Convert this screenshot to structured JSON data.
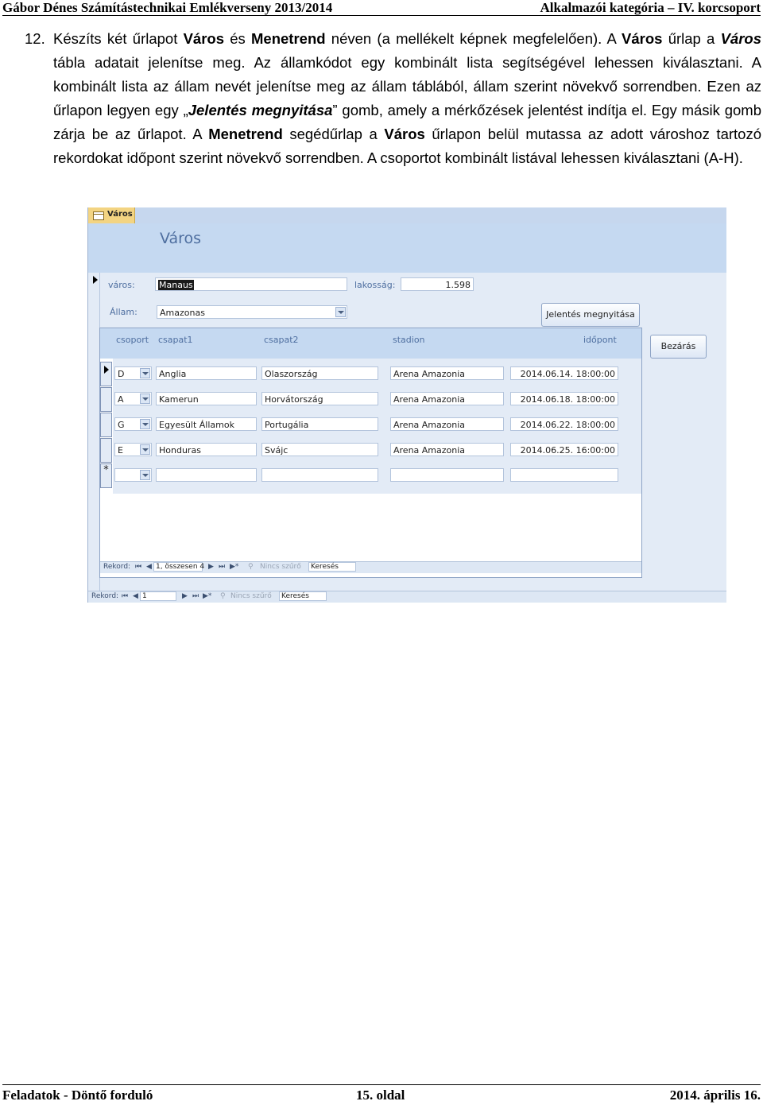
{
  "header": {
    "left": "Gábor Dénes Számítástechnikai Emlékverseny 2013/2014",
    "right": "Alkalmazói kategória – IV. korcsoport"
  },
  "task": {
    "number": "12.",
    "text_parts": [
      "Készíts két űrlapot ",
      "Város",
      " és ",
      "Menetrend",
      " néven (a mellékelt képnek megfelelően). A ",
      "Város",
      " űrlap a ",
      "Város",
      " tábla adatait jelenítse meg. Az államkódot egy kombinált lista segítségével lehessen kiválasztani. A kombinált lista az állam nevét jelenítse meg az állam táblából, állam szerint növekvő sorrendben. Ezen az űrlapon legyen egy „",
      "Jelentés megnyitása",
      "” gomb, amely a mérkőzések jelentést indítja el. Egy másik gomb zárja be az űrlapot. A ",
      "Menetrend",
      " segédűrlap a ",
      "Város",
      " űrlapon belül mutassa az adott városhoz tartozó rekordokat időpont szerint növekvő sorrendben. A csoportot kombinált listával lehessen kiválasztani (A-H)."
    ]
  },
  "form": {
    "tab_label": "Város",
    "title": "Város",
    "varos_label": "város:",
    "varos_value": "Manaus",
    "lakossag_label": "lakosság:",
    "lakossag_value": "1.598",
    "allam_label": "Állam:",
    "allam_value": "Amazonas",
    "report_button": "Jelentés megnyitása",
    "close_button": "Bezárás",
    "subform": {
      "columns": [
        "csoport",
        "csapat1",
        "csapat2",
        "stadion",
        "időpont"
      ],
      "rows": [
        {
          "csoport": "D",
          "csapat1": "Anglia",
          "csapat2": "Olaszország",
          "stadion": "Arena Amazonia",
          "idopont": "2014.06.14. 18:00:00"
        },
        {
          "csoport": "A",
          "csapat1": "Kamerun",
          "csapat2": "Horvátország",
          "stadion": "Arena Amazonia",
          "idopont": "2014.06.18. 18:00:00"
        },
        {
          "csoport": "G",
          "csapat1": "Egyesült Államok",
          "csapat2": "Portugália",
          "stadion": "Arena Amazonia",
          "idopont": "2014.06.22. 18:00:00"
        },
        {
          "csoport": "E",
          "csapat1": "Honduras",
          "csapat2": "Svájc",
          "stadion": "Arena Amazonia",
          "idopont": "2014.06.25. 16:00:00"
        }
      ],
      "new_row_marker": "*",
      "nav": {
        "label": "Rekord:",
        "position": "1, összesen 4",
        "filter": "Nincs szűrő",
        "search": "Keresés"
      }
    },
    "nav": {
      "label": "Rekord:",
      "position": "1",
      "filter": "Nincs szűrő",
      "search": "Keresés"
    }
  },
  "footer": {
    "left": "Feladatok - Döntő forduló",
    "center": "15. oldal",
    "right": "2014. április 16."
  }
}
